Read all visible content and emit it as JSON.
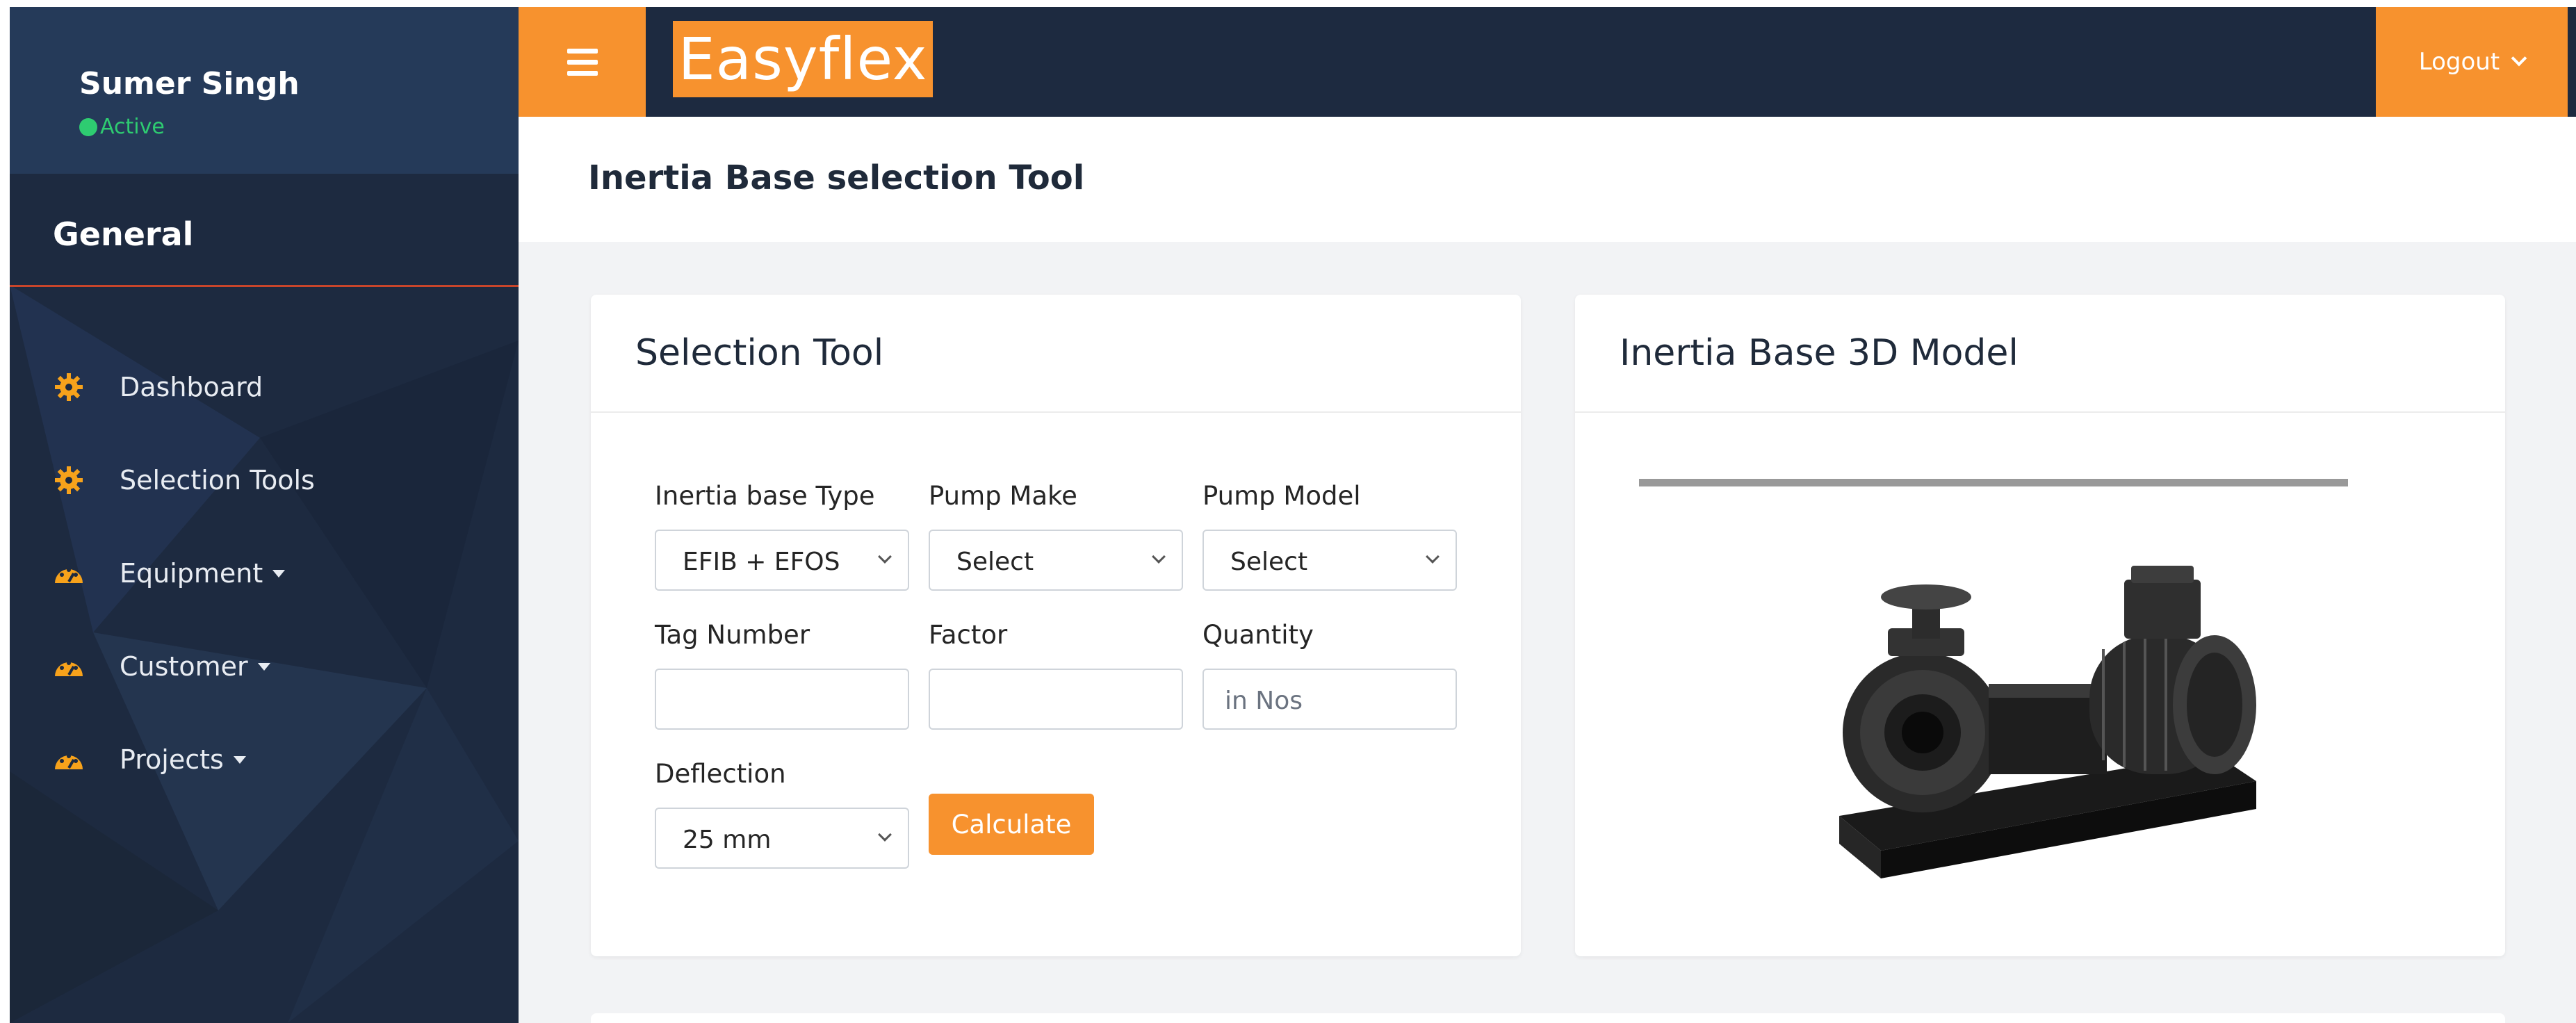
{
  "user": {
    "name": "Sumer Singh",
    "status": "Active"
  },
  "sidebar": {
    "section_title": "General",
    "items": [
      {
        "label": "Dashboard",
        "icon": "gear-icon",
        "has_caret": false
      },
      {
        "label": "Selection Tools",
        "icon": "gear-icon",
        "has_caret": false
      },
      {
        "label": "Equipment",
        "icon": "gauge-icon",
        "has_caret": true
      },
      {
        "label": "Customer",
        "icon": "gauge-icon",
        "has_caret": true
      },
      {
        "label": "Projects",
        "icon": "gauge-icon",
        "has_caret": true
      }
    ]
  },
  "topbar": {
    "brand": "Easyflex",
    "logout_label": "Logout"
  },
  "page": {
    "title": "Inertia Base selection Tool"
  },
  "selection_tool": {
    "title": "Selection Tool",
    "fields": {
      "inertia_base_type": {
        "label": "Inertia base Type",
        "value": "EFIB + EFOS"
      },
      "pump_make": {
        "label": "Pump Make",
        "value": "Select"
      },
      "pump_model": {
        "label": "Pump Model",
        "value": "Select"
      },
      "tag_number": {
        "label": "Tag Number",
        "value": ""
      },
      "factor": {
        "label": "Factor",
        "value": ""
      },
      "quantity": {
        "label": "Quantity",
        "placeholder": "in Nos"
      },
      "deflection": {
        "label": "Deflection",
        "value": "25 mm"
      }
    },
    "calculate_label": "Calculate"
  },
  "model_card": {
    "title": "Inertia Base 3D Model"
  },
  "colors": {
    "accent": "#f7922e",
    "navy": "#1d2a40",
    "status_green": "#2ecc71",
    "divider_red": "#c8452b"
  }
}
